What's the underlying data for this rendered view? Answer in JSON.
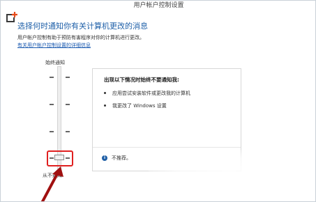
{
  "window": {
    "title": "用户帐户控制设置"
  },
  "app_icon": {
    "name": "uac-window-icon",
    "accent_color": "#e84b1a",
    "frame_color": "#3a3a3a"
  },
  "content": {
    "heading": "选择何时通知你有关计算机更改的消息",
    "description": "用户帐户控制有助于预防有害程序对你的计算机进行更改。",
    "help_link": "有关用户帐户控制设置的详细信息"
  },
  "slider": {
    "top_label": "始终通知",
    "bottom_label": "从不通知",
    "levels": 4,
    "selected_level": 1,
    "selected_level_note": "lowest of 4 levels"
  },
  "info_panel": {
    "title": "出现以下情况时始终不要通知我:",
    "bullets": [
      "应用尝试安装软件或更改我的计算机",
      "我更改了 Windows 设置"
    ],
    "info_icon": "info-icon",
    "info_text": "不推荐。"
  },
  "annotations": {
    "highlight_color": "#e02020",
    "arrow_color": "#a01010"
  }
}
